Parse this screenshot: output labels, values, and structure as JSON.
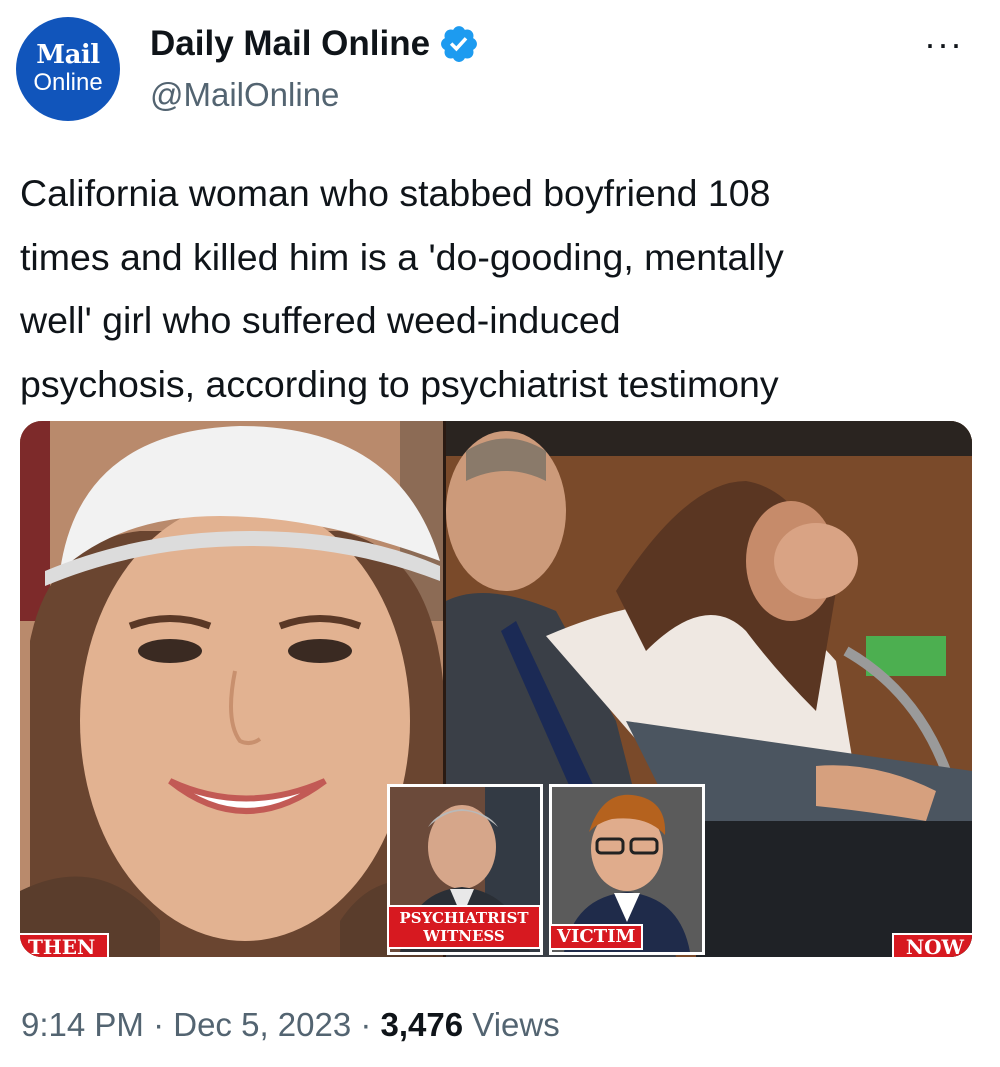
{
  "account": {
    "avatar_line1": "Mail",
    "avatar_line2": "Online",
    "display_name": "Daily Mail Online",
    "handle": "@MailOnline",
    "more_icon": "···"
  },
  "tweet": {
    "text": "California woman who stabbed boyfriend 108\ntimes and killed him is a 'do-gooding, mentally\nwell' girl who suffered weed-induced\npsychosis, according to psychiatrist testimony"
  },
  "media": {
    "tag_then": "THEN",
    "tag_now": "NOW",
    "tag_psychiatrist": "PSYCHIATRIST WITNESS",
    "tag_victim": "VICTIM"
  },
  "meta": {
    "time": "9:14 PM",
    "separator": " · ",
    "date": "Dec 5, 2023",
    "views_count": "3,476",
    "views_label": "Views"
  },
  "colors": {
    "accent_blue": "#1d9bf0",
    "avatar_blue": "#1155bb",
    "tag_red": "#d71920",
    "secondary_text": "#536471"
  }
}
